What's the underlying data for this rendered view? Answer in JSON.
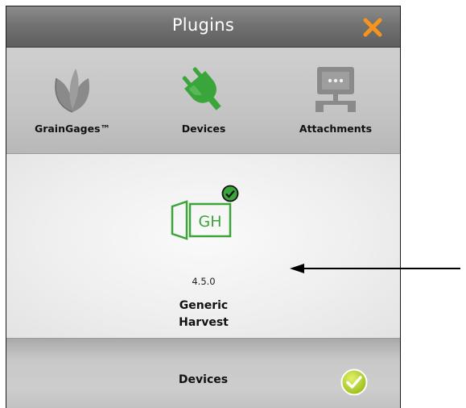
{
  "titlebar": {
    "title": "Plugins",
    "close_icon": "close-icon",
    "accent": "#f7941d"
  },
  "tabs": [
    {
      "label": "GrainGages™",
      "icon": "grain-leaf-icon"
    },
    {
      "label": "Devices",
      "icon": "plug-icon",
      "selected": true
    },
    {
      "label": "Attachments",
      "icon": "network-device-icon"
    }
  ],
  "plugin": {
    "icon_text": "GH",
    "version": "4.5.0",
    "name_line1": "Generic",
    "name_line2": "Harvest",
    "installed": true,
    "brand_color": "#3aa53a"
  },
  "footer": {
    "label": "Devices",
    "confirm_icon": "checkmark-circle-icon"
  }
}
